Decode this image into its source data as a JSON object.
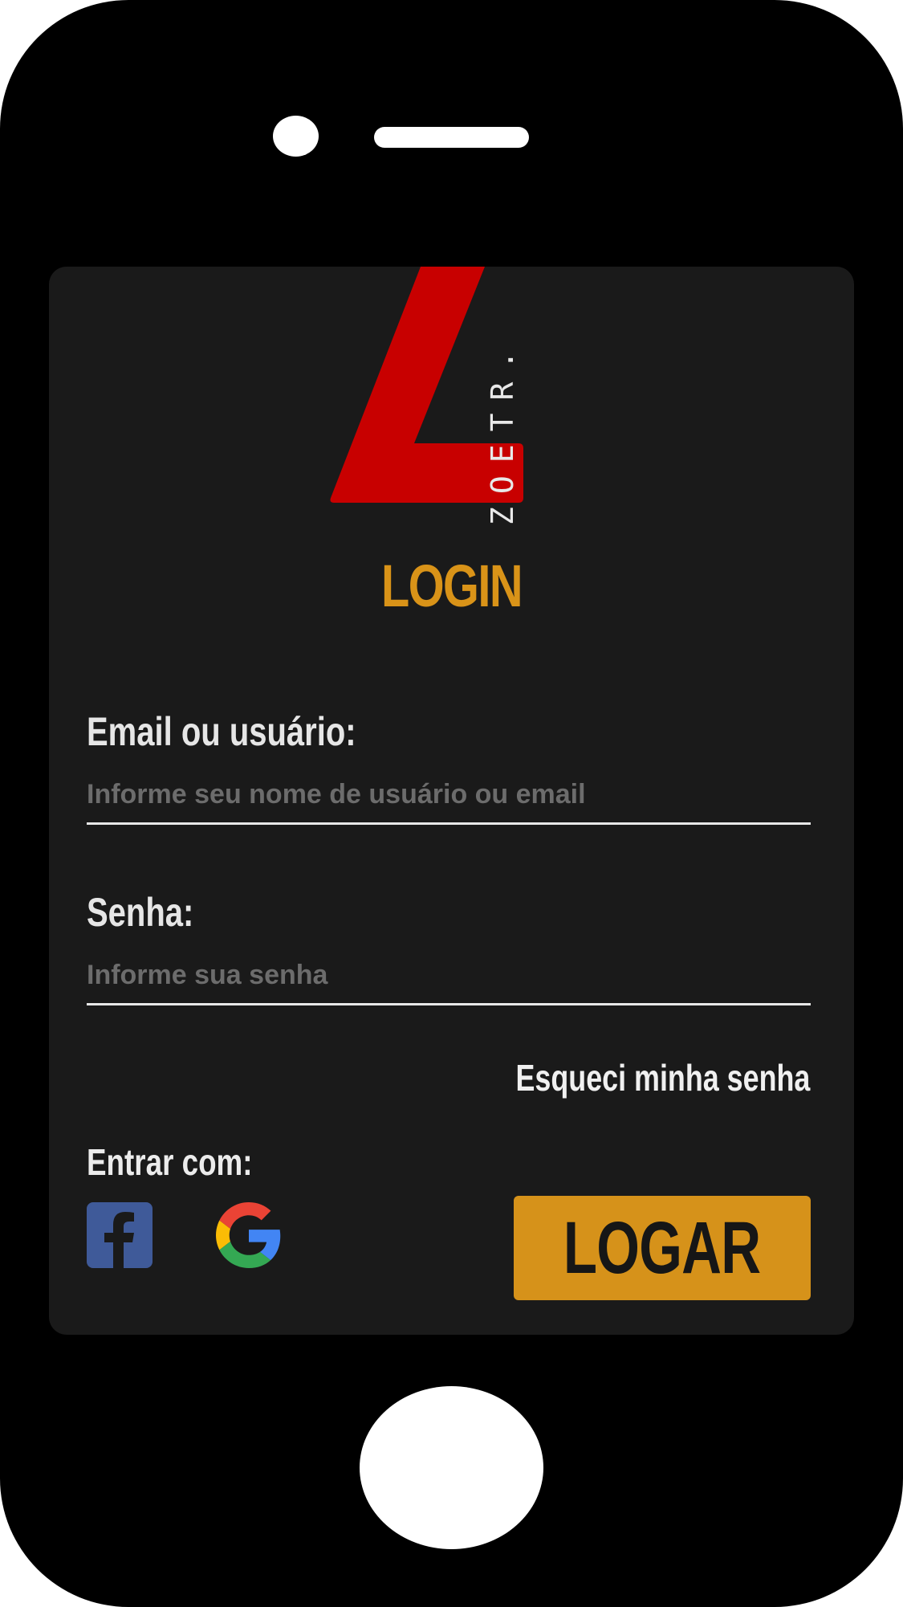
{
  "brand": {
    "name": "ZOETR.",
    "logo_letter_color": "#c80000"
  },
  "login": {
    "title": "LOGIN",
    "title_color": "#d99318"
  },
  "email_field": {
    "label": "Email ou usuário:",
    "placeholder": "Informe seu nome de usuário ou email",
    "value": ""
  },
  "password_field": {
    "label": "Senha:",
    "placeholder": "Informe sua senha",
    "value": ""
  },
  "forgot_password": {
    "label": "Esqueci minha senha"
  },
  "social": {
    "label": "Entrar com:",
    "providers": [
      {
        "name": "facebook",
        "icon": "facebook-icon",
        "color": "#3b5998"
      },
      {
        "name": "google",
        "icon": "google-icon"
      }
    ]
  },
  "submit": {
    "label": "LOGAR",
    "color": "#d6921a"
  },
  "colors": {
    "screen_bg": "#1a1a1a",
    "phone_body": "#000000"
  }
}
